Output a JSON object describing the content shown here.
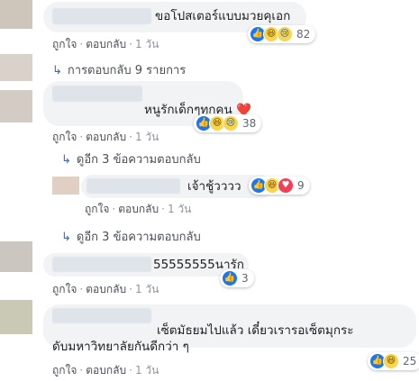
{
  "meta_labels": {
    "like": "ถูกใจ",
    "reply": "ตอบกลับ",
    "sep": "·"
  },
  "comments": [
    {
      "text": "ขอโปสเตอร์แบบมวยคุเอก",
      "time": "1 วัน",
      "reactions": {
        "icons": [
          "like-icon",
          "haha-icon",
          "sad-icon"
        ],
        "count": "82"
      }
    },
    {
      "text": "หนูรักเด็กๆทุกคน ❤️",
      "time": "1 วัน",
      "reactions": {
        "icons": [
          "like-icon",
          "haha-icon",
          "sad-icon"
        ],
        "count": "38"
      }
    },
    {
      "text": "เจ้าชู้วววว",
      "time": "1 วัน",
      "reactions": {
        "icons": [
          "like-icon",
          "haha-icon",
          "love-icon"
        ],
        "count": "9"
      }
    },
    {
      "text": "55555555นารัก",
      "time": "1 วัน",
      "reactions": {
        "icons": [
          "like-icon"
        ],
        "count": "3"
      }
    },
    {
      "text": "เซ็ตมัธยมไปแล้ว เดี๋ยวเรารอเซ็ตมุกระดับมหาวิทยาลัยกันดีกว่า ๆ",
      "time": "1 วัน",
      "reactions": {
        "icons": [
          "like-icon",
          "haha-icon"
        ],
        "count": "25"
      }
    }
  ],
  "reply_links": {
    "view_replies": "การตอบกลับ 9 รายการ",
    "more_replies_1": "ดูอีก 3 ข้อความตอบกลับ",
    "more_replies_2": "ดูอีก 3 ข้อความตอบกลับ"
  }
}
